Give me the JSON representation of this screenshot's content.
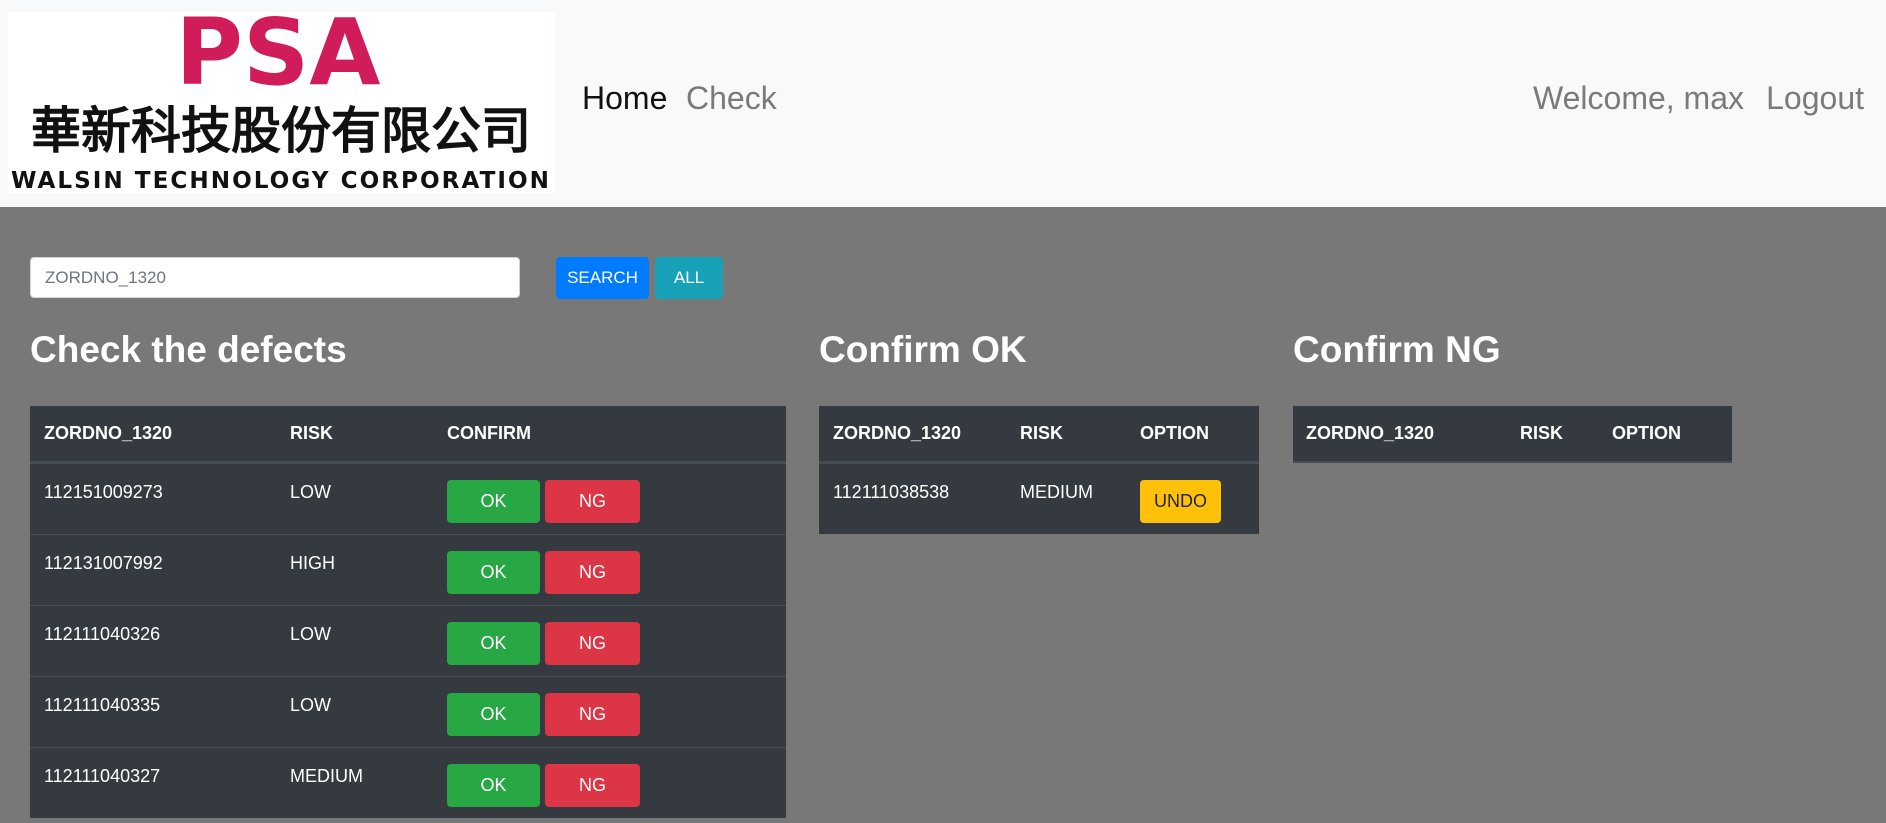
{
  "nav": {
    "logo": {
      "brand": "PSA",
      "chinese_name": "華新科技股份有限公司",
      "english_name": "WALSIN TECHNOLOGY CORPORATION",
      "brand_color": "#d01c58"
    },
    "home_label": "Home",
    "check_label": "Check",
    "welcome_text": "Welcome, max",
    "logout_label": "Logout"
  },
  "search": {
    "placeholder": "ZORDNO_1320",
    "value": "",
    "search_label": "SEARCH",
    "all_label": "ALL"
  },
  "defects": {
    "title": "Check the defects",
    "columns": [
      "ZORDNO_1320",
      "RISK",
      "CONFIRM"
    ],
    "ok_label": "OK",
    "ng_label": "NG",
    "rows": [
      {
        "zordno": "112151009273",
        "risk": "LOW"
      },
      {
        "zordno": "112131007992",
        "risk": "HIGH"
      },
      {
        "zordno": "112111040326",
        "risk": "LOW"
      },
      {
        "zordno": "112111040335",
        "risk": "LOW"
      },
      {
        "zordno": "112111040327",
        "risk": "MEDIUM"
      }
    ]
  },
  "confirm_ok": {
    "title": "Confirm OK",
    "columns": [
      "ZORDNO_1320",
      "RISK",
      "OPTION"
    ],
    "undo_label": "UNDO",
    "rows": [
      {
        "zordno": "112111038538",
        "risk": "MEDIUM"
      }
    ]
  },
  "confirm_ng": {
    "title": "Confirm NG",
    "columns": [
      "ZORDNO_1320",
      "RISK",
      "OPTION"
    ],
    "rows": []
  },
  "colors": {
    "ok": "#28a745",
    "ng": "#dc3545",
    "search": "#007bff",
    "all": "#17a2b8",
    "undo": "#ffc107",
    "table_bg": "#343a40",
    "page_bg": "#787878"
  }
}
